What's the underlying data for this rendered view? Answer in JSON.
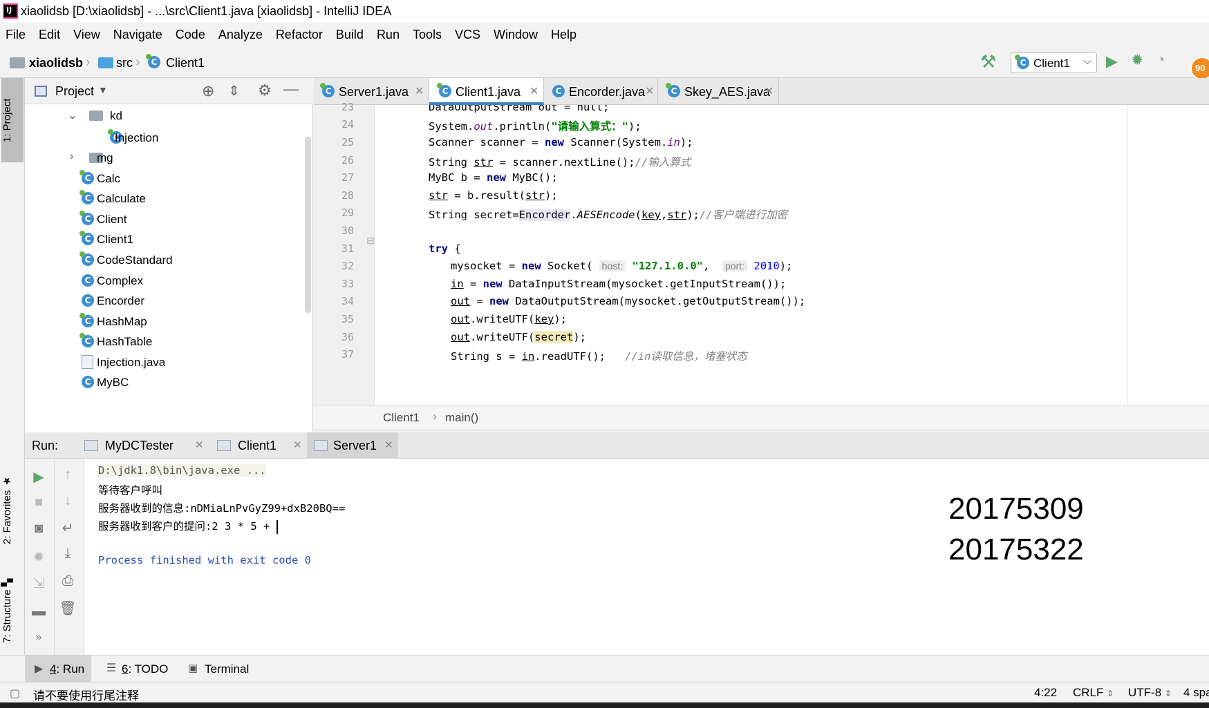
{
  "window": {
    "logo_text": "IJ",
    "title": "xiaolidsb [D:\\xiaolidsb] - ...\\src\\Client1.java [xiaolidsb] - IntelliJ IDEA"
  },
  "menu": [
    "File",
    "Edit",
    "View",
    "Navigate",
    "Code",
    "Analyze",
    "Refactor",
    "Build",
    "Run",
    "Tools",
    "VCS",
    "Window",
    "Help"
  ],
  "navbar": {
    "crumbs": [
      "xiaolidsb",
      "src",
      "Client1"
    ],
    "run_config": "Client1",
    "badge": "90"
  },
  "left_stripe": {
    "project": "1: Project",
    "favorites": "2: Favorites",
    "structure": "7: Structure"
  },
  "project_panel": {
    "title": "Project",
    "tree": [
      {
        "label": "kd",
        "kind": "folder",
        "expanded": true
      },
      {
        "label": "Injection",
        "kind": "class-green"
      },
      {
        "label": "mg",
        "kind": "folder",
        "expanded": false
      },
      {
        "label": "Calc",
        "kind": "class-green"
      },
      {
        "label": "Calculate",
        "kind": "class-green"
      },
      {
        "label": "Client",
        "kind": "class-green"
      },
      {
        "label": "Client1",
        "kind": "class-green"
      },
      {
        "label": "CodeStandard",
        "kind": "class-green"
      },
      {
        "label": "Complex",
        "kind": "class"
      },
      {
        "label": "Encorder",
        "kind": "class"
      },
      {
        "label": "HashMap",
        "kind": "class-green"
      },
      {
        "label": "HashTable",
        "kind": "class-green"
      },
      {
        "label": "Injection.java",
        "kind": "file"
      },
      {
        "label": "MyBC",
        "kind": "class"
      }
    ]
  },
  "editor": {
    "tabs": [
      {
        "label": "Server1.java",
        "active": false
      },
      {
        "label": "Client1.java",
        "active": true
      },
      {
        "label": "Encorder.java",
        "active": false
      },
      {
        "label": "Skey_AES.java",
        "active": false
      }
    ],
    "line_numbers": [
      "23",
      "24",
      "25",
      "26",
      "27",
      "28",
      "29",
      "30",
      "31",
      "32",
      "33",
      "34",
      "35",
      "36",
      "37"
    ],
    "code": {
      "l23": "DataOutputStream out = null;",
      "l24_a": "System.",
      "l24_b": "out",
      "l24_c": ".println(",
      "l24_d": "\"请输入算式：\"",
      "l24_e": ");",
      "l25_a": "Scanner scanner = ",
      "l25_b": "new",
      "l25_c": " Scanner(System.",
      "l25_d": "in",
      "l25_e": ");",
      "l26_a": "String ",
      "l26_b": "str",
      "l26_c": " = scanner.nextLine();",
      "l26_d": "//输入算式",
      "l27_a": "MyBC b = ",
      "l27_b": "new",
      "l27_c": " MyBC();",
      "l28_a": "str",
      "l28_b": " = b.result(",
      "l28_c": "str",
      "l28_d": ");",
      "l29_a": "String secret=",
      "l29_b": "Encorder",
      "l29_c": ".",
      "l29_d": "AESEncode",
      "l29_e": "(",
      "l29_f": "key",
      "l29_g": ",",
      "l29_h": "str",
      "l29_i": ");",
      "l29_j": "//客户端进行加密",
      "l31_a": "try",
      "l31_b": " {",
      "l32_a": "mysocket = ",
      "l32_b": "new",
      "l32_c": " Socket(",
      "l32_d": "host:",
      "l32_e": "\"127.1.0.0\"",
      "l32_f": ",  ",
      "l32_g": "port:",
      "l32_h": "2010",
      "l32_i": ");",
      "l33_a": "in",
      "l33_b": " = ",
      "l33_c": "new",
      "l33_d": " DataInputStream(mysocket.getInputStream());",
      "l34_a": "out",
      "l34_b": " = ",
      "l34_c": "new",
      "l34_d": " DataOutputStream(mysocket.getOutputStream());",
      "l35_a": "out",
      "l35_b": ".writeUTF(",
      "l35_c": "key",
      "l35_d": ");",
      "l36_a": "out",
      "l36_b": ".writeUTF(",
      "l36_c": "secret",
      "l36_d": ");",
      "l37_a": "String s = ",
      "l37_b": "in",
      "l37_c": ".readUTF();   ",
      "l37_d": "//in读取信息，堵塞状态"
    },
    "breadcrumbs": [
      "Client1",
      "main()"
    ]
  },
  "run": {
    "label": "Run:",
    "tabs": [
      {
        "label": "MyDCTester",
        "active": false
      },
      {
        "label": "Client1",
        "active": false
      },
      {
        "label": "Server1",
        "active": true
      }
    ],
    "console": [
      "D:\\jdk1.8\\bin\\java.exe ...",
      "等待客户呼叫",
      "服务器收到的信息:nDMiaLnPvGyZ99+dxB20BQ==",
      "服务器收到客户的提问:2 3 * 5 + ",
      "Process finished with exit code 0"
    ],
    "overlay": [
      "20175309",
      "20175322"
    ]
  },
  "bottom_tools": [
    {
      "key": "4",
      "label": ": Run"
    },
    {
      "key": "6",
      "label": ": TODO"
    },
    {
      "key": "",
      "label": "Terminal"
    }
  ],
  "status": {
    "message": "请不要使用行尾注释",
    "position": "4:22",
    "line_sep": "CRLF",
    "encoding": "UTF-8",
    "indent": "4 spa"
  },
  "colors": {
    "accent": "#4083c9",
    "run_green": "#59a869",
    "keyword": "#000080",
    "string": "#008000",
    "comment": "#808080"
  }
}
